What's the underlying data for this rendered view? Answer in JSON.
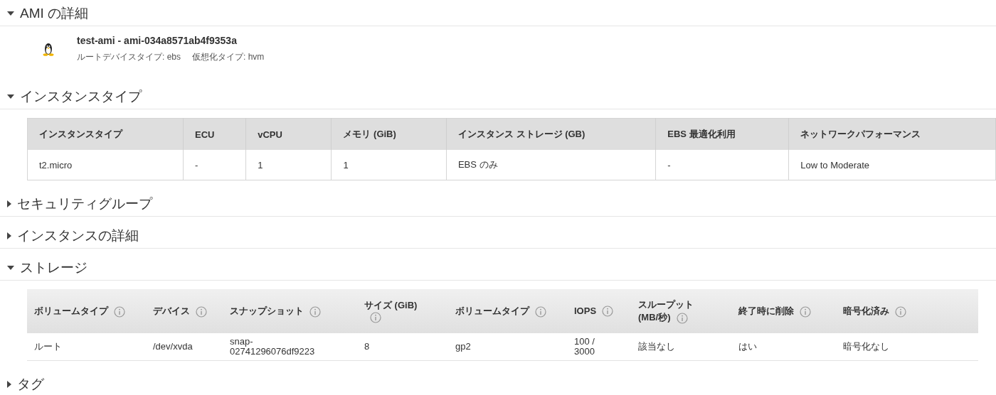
{
  "sections": [
    {
      "title": "AMI の詳細",
      "expanded": true,
      "kind": "ami",
      "ami": {
        "name": "test-ami - ami-034a8571ab4f9353a",
        "meta": [
          "ルートデバイスタイプ: ebs",
          "仮想化タイプ: hvm"
        ]
      }
    },
    {
      "title": "インスタンスタイプ",
      "expanded": true,
      "kind": "plain-table",
      "table": {
        "columns": [
          "インスタンスタイプ",
          "ECU",
          "vCPU",
          "メモリ (GiB)",
          "インスタンス ストレージ (GB)",
          "EBS 最適化利用",
          "ネットワークパフォーマンス"
        ],
        "rows": [
          [
            "t2.micro",
            "-",
            "1",
            "1",
            "EBS のみ",
            "-",
            "Low to Moderate"
          ]
        ]
      }
    },
    {
      "title": "セキュリティグループ",
      "expanded": false
    },
    {
      "title": "インスタンスの詳細",
      "expanded": false
    },
    {
      "title": "ストレージ",
      "expanded": true,
      "kind": "info-table",
      "table": {
        "columns": [
          "ボリュームタイプ",
          "デバイス",
          "スナップショット",
          "サイズ (GiB)",
          "ボリュームタイプ",
          "IOPS",
          "スループット (MB/秒)",
          "終了時に削除",
          "暗号化済み"
        ],
        "rows": [
          [
            "ルート",
            "/dev/xvda",
            "snap-02741296076df9223",
            "8",
            "gp2",
            "100 / 3000",
            "該当なし",
            "はい",
            "暗号化なし"
          ]
        ]
      }
    },
    {
      "title": "タグ",
      "expanded": false
    }
  ]
}
